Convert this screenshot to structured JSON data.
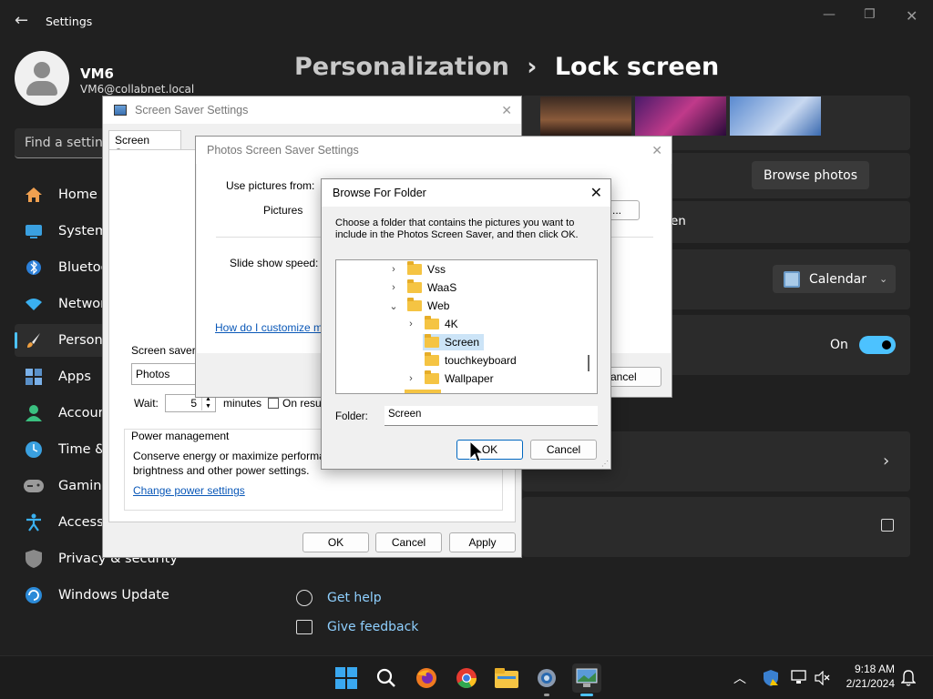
{
  "settings": {
    "app_title": "Settings",
    "user": {
      "name": "VM6",
      "email": "VM6@collabnet.local"
    },
    "search_placeholder": "Find a setting",
    "breadcrumb": {
      "parent": "Personalization",
      "separator": "›",
      "current": "Lock screen"
    },
    "nav": [
      {
        "label": "Home",
        "icon": "home-icon"
      },
      {
        "label": "System",
        "icon": "system-icon"
      },
      {
        "label": "Bluetooth & devices",
        "icon": "bluetooth-icon"
      },
      {
        "label": "Network & internet",
        "icon": "network-icon"
      },
      {
        "label": "Personalization",
        "icon": "brush-icon"
      },
      {
        "label": "Apps",
        "icon": "apps-icon"
      },
      {
        "label": "Accounts",
        "icon": "accounts-icon"
      },
      {
        "label": "Time & language",
        "icon": "time-icon"
      },
      {
        "label": "Gaming",
        "icon": "gaming-icon"
      },
      {
        "label": "Accessibility",
        "icon": "accessibility-icon"
      },
      {
        "label": "Privacy & security",
        "icon": "shield-icon"
      },
      {
        "label": "Windows Update",
        "icon": "update-icon"
      }
    ],
    "browse_photos": "Browse photos",
    "lockscreen_status_fragment": "en",
    "status_app": "Calendar",
    "toggle_label": "On",
    "toggle_on": true,
    "get_help": "Get help",
    "give_feedback": "Give feedback"
  },
  "screen_saver_dialog": {
    "title": "Screen Saver Settings",
    "tab": "Screen Saver",
    "group_label": "Screen saver",
    "selected_saver": "Photos",
    "wait_label": "Wait:",
    "wait_value": "5",
    "minutes_label": "minutes",
    "on_resume_label": "On resume, display logon screen",
    "power_group": "Power management",
    "power_text_line1": "Conserve energy or maximize performance by adjusting display",
    "power_text_line2": "brightness and other power settings.",
    "power_link": "Change power settings",
    "ok": "OK",
    "cancel": "Cancel",
    "apply": "Apply"
  },
  "photos_dialog": {
    "title": "Photos Screen Saver Settings",
    "use_pictures_label": "Use pictures from:",
    "pictures_value": "Pictures",
    "browse_fragment": "...",
    "speed_label": "Slide show speed:",
    "help_link": "How do I customize my screen saver?",
    "cancel_fragment": "ancel"
  },
  "browse_dialog": {
    "title": "Browse For Folder",
    "instructions_line1": "Choose a folder that contains the pictures you want to",
    "instructions_line2": "include in the Photos Screen Saver, and then click OK.",
    "tree": [
      {
        "label": "Vss",
        "chevron": "›",
        "level": 0
      },
      {
        "label": "WaaS",
        "chevron": "›",
        "level": 0
      },
      {
        "label": "Web",
        "chevron": "⌄",
        "level": 0
      },
      {
        "label": "4K",
        "chevron": "›",
        "level": 1
      },
      {
        "label": "Screen",
        "chevron": "",
        "level": 1,
        "selected": true
      },
      {
        "label": "touchkeyboard",
        "chevron": "",
        "level": 1
      },
      {
        "label": "Wallpaper",
        "chevron": "›",
        "level": 1
      }
    ],
    "folder_label": "Folder:",
    "folder_value": "Screen",
    "ok": "OK",
    "cancel": "Cancel"
  },
  "taskbar": {
    "time": "9:18 AM",
    "date": "2/21/2024",
    "apps": [
      "start-icon",
      "search-icon",
      "firefox-icon",
      "chrome-icon",
      "file-explorer-icon",
      "settings-icon",
      "screensaver-app-icon"
    ]
  }
}
